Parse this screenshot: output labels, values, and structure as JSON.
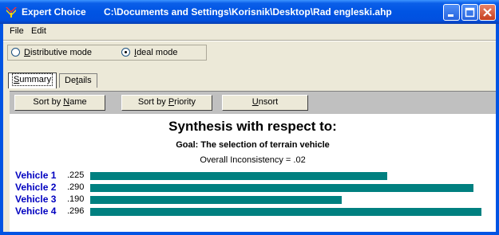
{
  "window": {
    "app_name": "Expert Choice",
    "file_path": "C:\\Documents and Settings\\Korisnik\\Desktop\\Rad engleski.ahp"
  },
  "menu": [
    "File",
    "Edit"
  ],
  "modes": {
    "distributive_label": "Distributive mode",
    "ideal_label": "Ideal mode",
    "selected": "ideal"
  },
  "tabs": [
    {
      "label": "Summary",
      "active": true
    },
    {
      "label": "Details",
      "active": false
    }
  ],
  "toolbar": {
    "sort_name_label": "Sort by Name",
    "sort_priority_label": "Sort by Priority",
    "unsort_label": "Unsort"
  },
  "synthesis": {
    "title": "Synthesis with respect to:",
    "goal": "Goal: The selection of terrain vehicle",
    "inconsistency": "Overall Inconsistency = .02"
  },
  "chart_data": {
    "type": "bar",
    "orientation": "horizontal",
    "categories": [
      "Vehicle 1",
      "Vehicle 2",
      "Vehicle 3",
      "Vehicle 4"
    ],
    "values": [
      0.225,
      0.29,
      0.19,
      0.296
    ],
    "value_labels": [
      ".225",
      ".290",
      ".190",
      ".296"
    ],
    "bar_color": "#008080",
    "xlim": [
      0,
      0.296
    ]
  }
}
